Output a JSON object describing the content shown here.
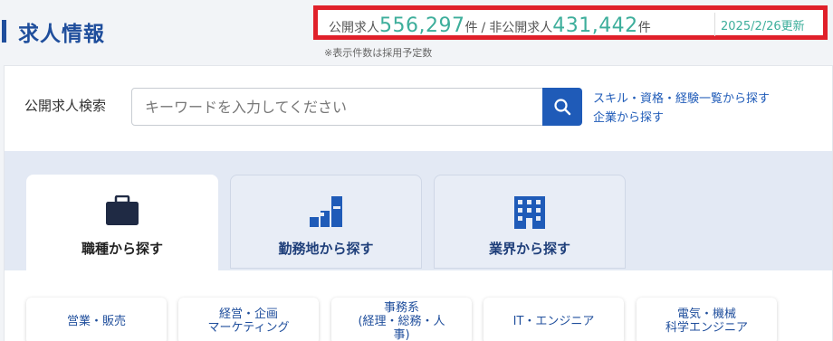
{
  "header": {
    "title": "求人情報",
    "public_label": "公開求人",
    "public_count": "556,297",
    "unit": "件",
    "separator": "/",
    "private_label": "非公開求人",
    "private_count": "431,442",
    "updated": "2025/2/26更新",
    "note": "※表示件数は採用予定数"
  },
  "search": {
    "label": "公開求人検索",
    "placeholder": "キーワードを入力してください",
    "button_icon": "search-icon",
    "links": [
      "スキル・資格・経験一覧から探す",
      "企業から探す"
    ]
  },
  "tabs": [
    {
      "label": "職種から探す",
      "icon": "briefcase-icon",
      "active": true
    },
    {
      "label": "勤務地から探す",
      "icon": "bar-blocks-icon",
      "active": false
    },
    {
      "label": "業界から探す",
      "icon": "building-icon",
      "active": false
    }
  ],
  "categories": [
    "営業・販売",
    "経営・企画\nマーケティング",
    "事務系\n(経理・総務・人\n事)",
    "IT・エンジニア",
    "電気・機械\n科学エンジニア"
  ],
  "colors": {
    "brand": "#1f4e9c",
    "count_accent": "#3dae9b",
    "highlight_border": "#e0202a",
    "search_button": "#1f5bb8"
  }
}
